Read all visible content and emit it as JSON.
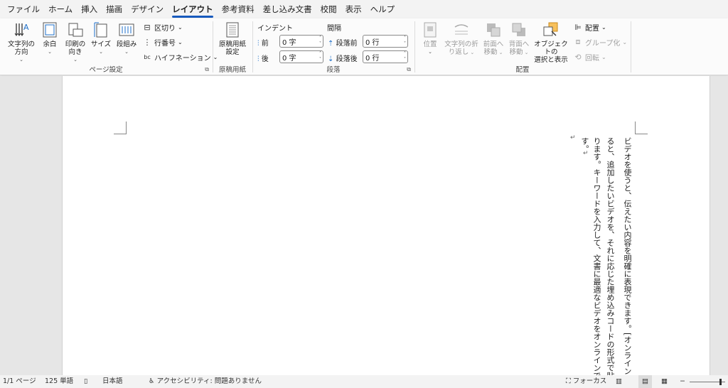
{
  "menu": {
    "tabs": [
      "ファイル",
      "ホーム",
      "挿入",
      "描画",
      "デザイン",
      "レイアウト",
      "参考資料",
      "差し込み文書",
      "校閲",
      "表示",
      "ヘルプ"
    ],
    "active": "レイアウト"
  },
  "ribbon": {
    "page_setup": {
      "label": "ページ設定",
      "text_direction": [
        "文字列の",
        "方向"
      ],
      "margins": "余白",
      "orientation": [
        "印刷の",
        "向き"
      ],
      "size": "サイズ",
      "columns": "段組み",
      "breaks": "区切り",
      "line_numbers": "行番号",
      "hyphenation": "ハイフネーション"
    },
    "manuscript": {
      "label": "原稿用紙",
      "settings": [
        "原稿用紙",
        "設定"
      ]
    },
    "paragraph": {
      "label": "段落",
      "indent_label": "インデント",
      "spacing_label": "間隔",
      "indent_before_label": "前",
      "indent_before_value": "0 字",
      "indent_after_label": "後",
      "indent_after_value": "0 字",
      "spacing_before_label": "段落前",
      "spacing_before_value": "0 行",
      "spacing_after_label": "段落後",
      "spacing_after_value": "0 行"
    },
    "arrange": {
      "label": "配置",
      "position": "位置",
      "wrap_text": [
        "文字列の折",
        "り返し"
      ],
      "bring_forward": [
        "前面へ",
        "移動"
      ],
      "send_backward": [
        "背面へ",
        "移動"
      ],
      "selection_pane": [
        "オブジェクトの",
        "選択と表示"
      ],
      "align": "配置",
      "group": "グループ化",
      "rotate": "回転"
    }
  },
  "document": {
    "lines": [
      "ビデオを使うと、伝えたい内容を明確に表現できます。[オンラインビ",
      "ると、追加したいビデオを、それに応じた埋め込みコードの形式で貼",
      "ります。キーワードを入力して、文書に最適なビデオをオンラインで",
      "す。"
    ],
    "paragraph_mark": "↵"
  },
  "status": {
    "page": "1/1 ページ",
    "words": "125 単語",
    "language": "日本語",
    "accessibility": "アクセシビリティ: 問題ありません",
    "focus": "フォーカス"
  }
}
